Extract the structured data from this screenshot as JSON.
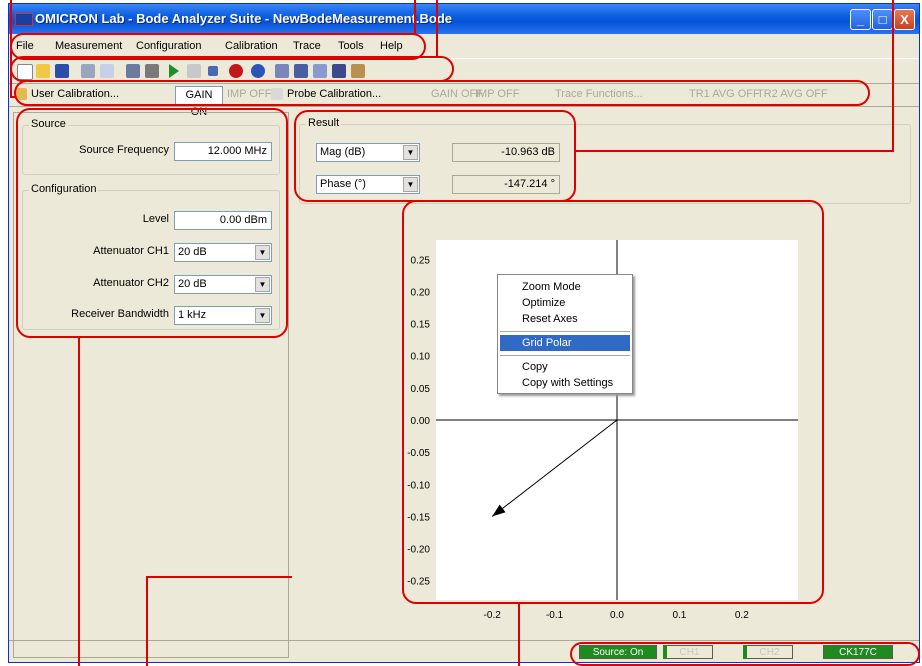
{
  "window": {
    "title": "OMICRON Lab - Bode Analyzer Suite - NewBodeMeasurement.Bode"
  },
  "titlebar_buttons": {
    "minimize": "_",
    "maximize": "□",
    "close": "X"
  },
  "menu": [
    "File",
    "Measurement",
    "Configuration",
    "Calibration",
    "Trace",
    "Tools",
    "Help"
  ],
  "toolbar_icons": [
    "new-icon",
    "open-icon",
    "save-icon",
    "print-icon",
    "preview-icon",
    "zoom-icon",
    "wrench-icon",
    "play-icon",
    "step-icon",
    "stop-icon",
    "cancel-icon",
    "help-icon",
    "chart1-icon",
    "chart2-icon",
    "chart3-icon",
    "chart4-icon",
    "chart5-icon"
  ],
  "toolbar2": {
    "user_cal": "User Calibration...",
    "gain_on": "GAIN ON",
    "imp_off": "IMP OFF",
    "probe_cal": "Probe Calibration...",
    "gain_off": "GAIN OFF",
    "imp_off2": "IMP OFF",
    "trace_functions": "Trace Functions...",
    "tr1_avg": "TR1 AVG OFF",
    "tr2_avg": "TR2 AVG OFF"
  },
  "source": {
    "group": "Source",
    "freq_label": "Source Frequency",
    "freq_value": "12.000 MHz"
  },
  "configuration": {
    "group": "Configuration",
    "level_label": "Level",
    "level_value": "0.00 dBm",
    "att1_label": "Attenuator CH1",
    "att1_value": "20 dB",
    "att2_label": "Attenuator CH2",
    "att2_value": "20 dB",
    "rbw_label": "Receiver Bandwidth",
    "rbw_value": "1 kHz"
  },
  "result": {
    "group": "Result",
    "mag_select": "Mag (dB)",
    "mag_value": "-10.963 dB",
    "phase_select": "Phase (°)",
    "phase_value": "-147.214 °"
  },
  "context_menu": {
    "zoom": "Zoom Mode",
    "optimize": "Optimize",
    "reset": "Reset Axes",
    "grid_polar": "Grid Polar",
    "copy": "Copy",
    "copy_settings": "Copy with Settings"
  },
  "status": {
    "source": "Source: On",
    "ch1": "CH1",
    "ch2": "CH2",
    "device": "CK177C"
  },
  "chart_data": {
    "type": "scatter",
    "x": [
      -0.2
    ],
    "y": [
      -0.15
    ],
    "xticks": [
      "-0.2",
      "-0.1",
      "0.0",
      "0.1",
      "0.2"
    ],
    "yticks": [
      "0.25",
      "0.20",
      "0.15",
      "0.10",
      "0.05",
      "0.00",
      "-0.05",
      "-0.10",
      "-0.15",
      "-0.20",
      "-0.25"
    ],
    "xlim": [
      -0.29,
      0.29
    ],
    "ylim": [
      -0.28,
      0.28
    ],
    "grid": false
  }
}
